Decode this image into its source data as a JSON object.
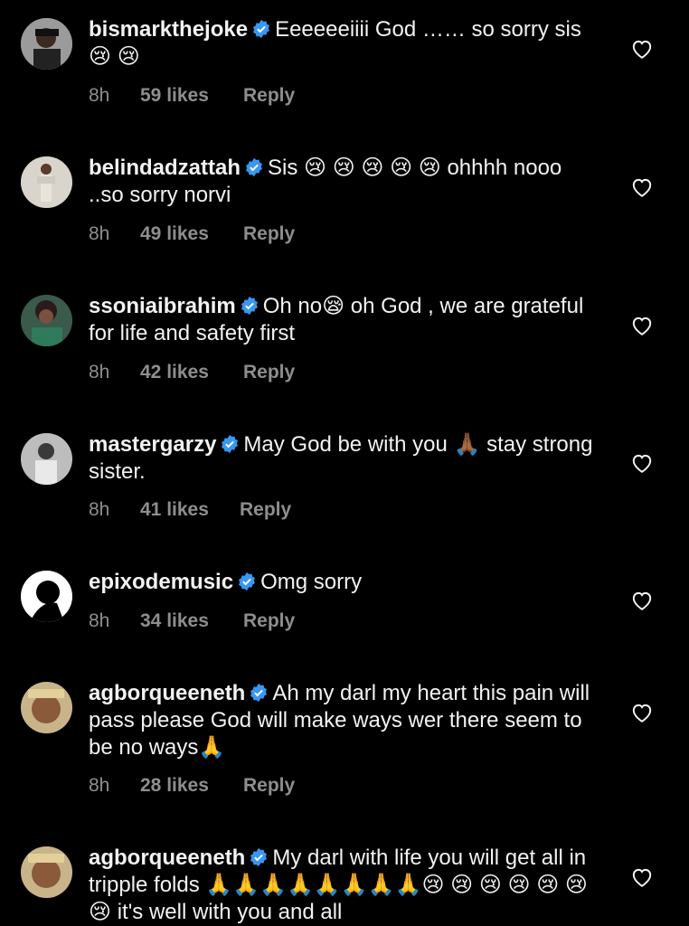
{
  "comments": [
    {
      "username": "bismarkthejoke",
      "text": "Eeeeeeiiii God …… so sorry sis 😢 😢",
      "time": "8h",
      "likes": "59 likes",
      "reply": "Reply"
    },
    {
      "username": "belindadzattah",
      "text": "Sis 😢 😢 😢 😢 😢  ohhhh nooo ..so sorry norvi",
      "time": "8h",
      "likes": "49 likes",
      "reply": "Reply"
    },
    {
      "username": "ssoniaibrahim",
      "text": "Oh no😪  oh God , we are grateful for life and safety first",
      "time": "8h",
      "likes": "42 likes",
      "reply": "Reply"
    },
    {
      "username": "mastergarzy",
      "text": "May God be with you 🙏🏾 stay strong sister.",
      "time": "8h",
      "likes": "41 likes",
      "reply": "Reply"
    },
    {
      "username": "epixodemusic",
      "text": "Omg sorry",
      "time": "8h",
      "likes": "34 likes",
      "reply": "Reply"
    },
    {
      "username": "agborqueeneth",
      "text": "Ah my darl my heart this pain will pass please God will make ways wer there seem to be no ways🙏",
      "time": "8h",
      "likes": "28 likes",
      "reply": "Reply"
    },
    {
      "username": "agborqueeneth",
      "text": "My darl with life you will get all in tripple folds 🙏🙏🙏🙏🙏🙏🙏🙏😢 😢 😢 😢 😢 😢 😢  it's well with you and all",
      "time": "",
      "likes": "",
      "reply": ""
    }
  ],
  "colors": {
    "background": "#000000",
    "text": "#f2f2f2",
    "meta": "#8e8e8e",
    "verified": "#3897f0"
  },
  "icons": {
    "verified": "verified-badge-icon",
    "like": "heart-outline-icon"
  }
}
